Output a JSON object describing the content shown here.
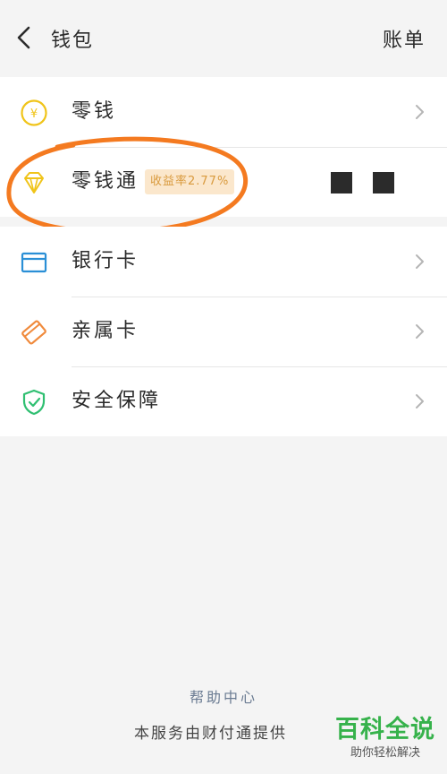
{
  "header": {
    "title": "钱包",
    "bills_label": "账单"
  },
  "wallet_items": [
    {
      "label": "零钱",
      "icon": "yen-coin-icon"
    },
    {
      "label": "零钱通",
      "icon": "diamond-icon",
      "badge": "收益率2.77%"
    }
  ],
  "card_items": [
    {
      "label": "银行卡",
      "icon": "bank-card-icon"
    },
    {
      "label": "亲属卡",
      "icon": "family-card-icon"
    },
    {
      "label": "安全保障",
      "icon": "shield-check-icon"
    }
  ],
  "footer": {
    "help_center": "帮助中心",
    "provider_text": "本服务由财付通提供"
  },
  "watermark": {
    "main": "百科全说",
    "sub": "助你轻松解决"
  },
  "colors": {
    "accent_yellow": "#f0c419",
    "accent_blue": "#2a8fd6",
    "accent_orange": "#f08a3c",
    "accent_green": "#2fbf71",
    "annotation_orange": "#f47a20",
    "watermark_green": "#36b24b"
  }
}
